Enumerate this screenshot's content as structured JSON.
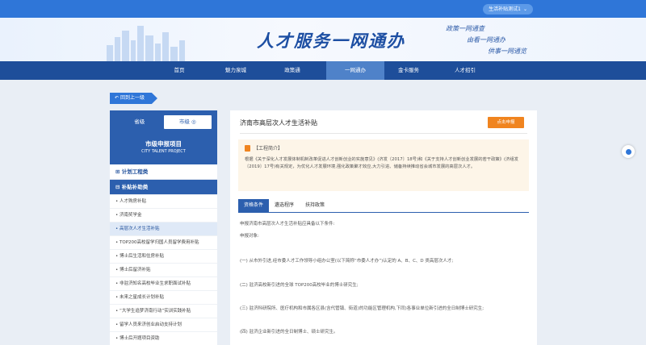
{
  "topbar": {
    "user_label": "生活补贴测试1",
    "chevron": "⌄"
  },
  "banner": {
    "title": "人才服务一网通办",
    "slogans": [
      "政策一网通查",
      "由看一网通办",
      "供事一网通览"
    ]
  },
  "nav": {
    "items": [
      {
        "label": "首页"
      },
      {
        "label": "魅力泉城"
      },
      {
        "label": "政策通"
      },
      {
        "label": "一网通办",
        "active": true
      },
      {
        "label": "金卡服务"
      },
      {
        "label": "人才招引"
      }
    ]
  },
  "back": {
    "label": "回到上一级"
  },
  "sidebar": {
    "tabs": [
      {
        "label": "省级"
      },
      {
        "label": "市级"
      }
    ],
    "heading": "市级申报项目",
    "heading_en": "CITY TALENT PROJECT",
    "sections": [
      {
        "label": "计划工程类"
      },
      {
        "label": "补贴补助类"
      }
    ],
    "items": [
      {
        "label": "人才购房补贴"
      },
      {
        "label": "济南奖学金"
      },
      {
        "label": "高层次人才生活补贴",
        "active": true
      },
      {
        "label": "TOP200高校留学归国人员留学费用补贴"
      },
      {
        "label": "博士后生活和住房补贴"
      },
      {
        "label": "博士后留济补贴"
      },
      {
        "label": "非驻济知名高校毕业生求职面试补贴"
      },
      {
        "label": "未来之星成长计划补贴"
      },
      {
        "label": "“大学生追梦济南行动”实训实践补贴"
      },
      {
        "label": "留学人员来济创业启动支持计划"
      },
      {
        "label": "博士后开题项目资助"
      }
    ]
  },
  "main": {
    "title": "济南市高层次人才生活补贴",
    "apply_label": "点击申报",
    "intro_heading": "【工程简介】",
    "intro_text": "根据《关于深化人才发展体制机制改革促进人才创新创业的实施意见》(济发〔2017〕18号)和《关于支持人才创新创业发展的若干政策》(济组发〔2019〕17号)有关规定，为优化人才发展环境,强化政策聚才效应,大力引进、储备持续推动省会城市发展的高层次人才。",
    "tabs": [
      {
        "label": "资格条件",
        "active": true
      },
      {
        "label": "遴选程序"
      },
      {
        "label": "扶持政策"
      }
    ],
    "paragraphs": [
      "申报济南市高层次人才生活补贴应具备以下条件:",
      "申报对象:",
      "(一) 从市外引进,经市委人才工作领导小组办公室(以下简称“市委人才办”)认定的 A、B、C、D 类高层次人才;",
      "(二) 驻济高校新引进的全球 TOP200高校毕业的博士研究生;",
      "(三) 驻济科研院所、医疗机构和市属各区县(含代管镇、街道)的功能区管理机构,下同)各事业单位新引进的全日制博士研究生;",
      "(四) 驻济企业新引进的全日制博士、硕士研究生。"
    ]
  },
  "icons": {
    "skyline": "skyline-graphic",
    "float": "float-circle-icon",
    "intro": "bookmark-icon",
    "back": "back-arrow-icon",
    "section": "list-icon",
    "item": "dot-icon",
    "level": "target-icon"
  },
  "colors": {
    "primary": "#2f76d8",
    "nav": "#1e4e9a",
    "accent": "#f0841f",
    "intro_bg": "#fdf5e8"
  }
}
